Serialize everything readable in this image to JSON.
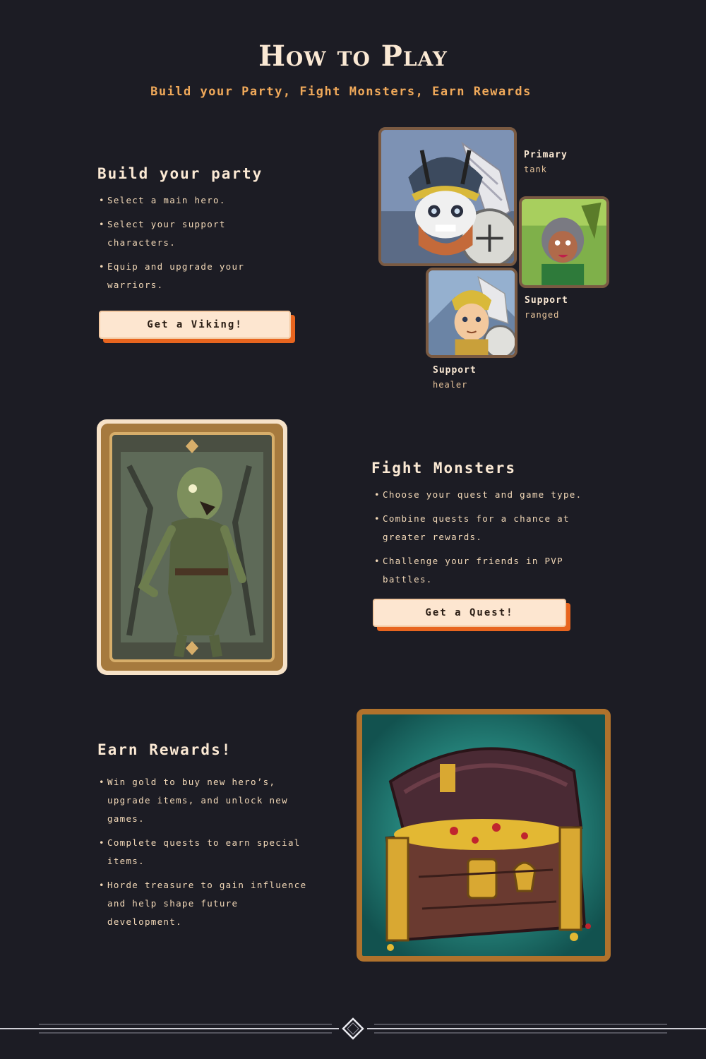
{
  "title": "How to Play",
  "subtitle": "Build your Party, Fight Monsters, Earn Rewards",
  "party": {
    "heading": "Build your party",
    "bullets": [
      "Select a main hero.",
      "Select your support characters.",
      "Equip and upgrade your warriors."
    ],
    "button_label": "Get a Viking!",
    "roles": [
      {
        "title": "Primary",
        "sub": "tank"
      },
      {
        "title": "Support",
        "sub": "ranged"
      },
      {
        "title": "Support",
        "sub": "healer"
      }
    ]
  },
  "monsters": {
    "heading": "Fight Monsters",
    "bullets": [
      "Choose your quest and game type.",
      "Combine quests for a chance at greater rewards.",
      "Challenge your friends in PVP battles."
    ],
    "button_label": "Get a Quest!"
  },
  "rewards": {
    "heading": "Earn Rewards!",
    "bullets": [
      "Win gold to buy new hero’s, upgrade items, and unlock new games.",
      "Complete quests to earn special items.",
      "Horde treasure to gain influence and help shape future development."
    ]
  },
  "colors": {
    "background": "#1c1c24",
    "accent_orange": "#e8651f",
    "button_bg": "#fde6d0",
    "subtitle": "#f0a95a"
  },
  "icons": [
    "viking-tank-portrait",
    "ranged-support-portrait",
    "healer-support-portrait",
    "zombie-card",
    "treasure-chest",
    "diamond-divider-icon"
  ]
}
